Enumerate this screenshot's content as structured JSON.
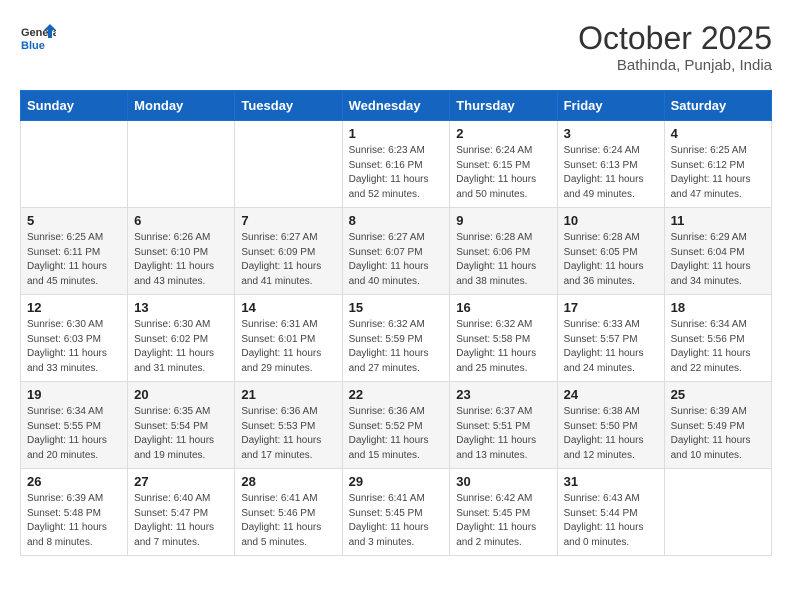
{
  "header": {
    "logo_line1": "General",
    "logo_line2": "Blue",
    "month_year": "October 2025",
    "location": "Bathinda, Punjab, India"
  },
  "days_of_week": [
    "Sunday",
    "Monday",
    "Tuesday",
    "Wednesday",
    "Thursday",
    "Friday",
    "Saturday"
  ],
  "weeks": [
    [
      {
        "day": "",
        "detail": ""
      },
      {
        "day": "",
        "detail": ""
      },
      {
        "day": "",
        "detail": ""
      },
      {
        "day": "1",
        "detail": "Sunrise: 6:23 AM\nSunset: 6:16 PM\nDaylight: 11 hours\nand 52 minutes."
      },
      {
        "day": "2",
        "detail": "Sunrise: 6:24 AM\nSunset: 6:15 PM\nDaylight: 11 hours\nand 50 minutes."
      },
      {
        "day": "3",
        "detail": "Sunrise: 6:24 AM\nSunset: 6:13 PM\nDaylight: 11 hours\nand 49 minutes."
      },
      {
        "day": "4",
        "detail": "Sunrise: 6:25 AM\nSunset: 6:12 PM\nDaylight: 11 hours\nand 47 minutes."
      }
    ],
    [
      {
        "day": "5",
        "detail": "Sunrise: 6:25 AM\nSunset: 6:11 PM\nDaylight: 11 hours\nand 45 minutes."
      },
      {
        "day": "6",
        "detail": "Sunrise: 6:26 AM\nSunset: 6:10 PM\nDaylight: 11 hours\nand 43 minutes."
      },
      {
        "day": "7",
        "detail": "Sunrise: 6:27 AM\nSunset: 6:09 PM\nDaylight: 11 hours\nand 41 minutes."
      },
      {
        "day": "8",
        "detail": "Sunrise: 6:27 AM\nSunset: 6:07 PM\nDaylight: 11 hours\nand 40 minutes."
      },
      {
        "day": "9",
        "detail": "Sunrise: 6:28 AM\nSunset: 6:06 PM\nDaylight: 11 hours\nand 38 minutes."
      },
      {
        "day": "10",
        "detail": "Sunrise: 6:28 AM\nSunset: 6:05 PM\nDaylight: 11 hours\nand 36 minutes."
      },
      {
        "day": "11",
        "detail": "Sunrise: 6:29 AM\nSunset: 6:04 PM\nDaylight: 11 hours\nand 34 minutes."
      }
    ],
    [
      {
        "day": "12",
        "detail": "Sunrise: 6:30 AM\nSunset: 6:03 PM\nDaylight: 11 hours\nand 33 minutes."
      },
      {
        "day": "13",
        "detail": "Sunrise: 6:30 AM\nSunset: 6:02 PM\nDaylight: 11 hours\nand 31 minutes."
      },
      {
        "day": "14",
        "detail": "Sunrise: 6:31 AM\nSunset: 6:01 PM\nDaylight: 11 hours\nand 29 minutes."
      },
      {
        "day": "15",
        "detail": "Sunrise: 6:32 AM\nSunset: 5:59 PM\nDaylight: 11 hours\nand 27 minutes."
      },
      {
        "day": "16",
        "detail": "Sunrise: 6:32 AM\nSunset: 5:58 PM\nDaylight: 11 hours\nand 25 minutes."
      },
      {
        "day": "17",
        "detail": "Sunrise: 6:33 AM\nSunset: 5:57 PM\nDaylight: 11 hours\nand 24 minutes."
      },
      {
        "day": "18",
        "detail": "Sunrise: 6:34 AM\nSunset: 5:56 PM\nDaylight: 11 hours\nand 22 minutes."
      }
    ],
    [
      {
        "day": "19",
        "detail": "Sunrise: 6:34 AM\nSunset: 5:55 PM\nDaylight: 11 hours\nand 20 minutes."
      },
      {
        "day": "20",
        "detail": "Sunrise: 6:35 AM\nSunset: 5:54 PM\nDaylight: 11 hours\nand 19 minutes."
      },
      {
        "day": "21",
        "detail": "Sunrise: 6:36 AM\nSunset: 5:53 PM\nDaylight: 11 hours\nand 17 minutes."
      },
      {
        "day": "22",
        "detail": "Sunrise: 6:36 AM\nSunset: 5:52 PM\nDaylight: 11 hours\nand 15 minutes."
      },
      {
        "day": "23",
        "detail": "Sunrise: 6:37 AM\nSunset: 5:51 PM\nDaylight: 11 hours\nand 13 minutes."
      },
      {
        "day": "24",
        "detail": "Sunrise: 6:38 AM\nSunset: 5:50 PM\nDaylight: 11 hours\nand 12 minutes."
      },
      {
        "day": "25",
        "detail": "Sunrise: 6:39 AM\nSunset: 5:49 PM\nDaylight: 11 hours\nand 10 minutes."
      }
    ],
    [
      {
        "day": "26",
        "detail": "Sunrise: 6:39 AM\nSunset: 5:48 PM\nDaylight: 11 hours\nand 8 minutes."
      },
      {
        "day": "27",
        "detail": "Sunrise: 6:40 AM\nSunset: 5:47 PM\nDaylight: 11 hours\nand 7 minutes."
      },
      {
        "day": "28",
        "detail": "Sunrise: 6:41 AM\nSunset: 5:46 PM\nDaylight: 11 hours\nand 5 minutes."
      },
      {
        "day": "29",
        "detail": "Sunrise: 6:41 AM\nSunset: 5:45 PM\nDaylight: 11 hours\nand 3 minutes."
      },
      {
        "day": "30",
        "detail": "Sunrise: 6:42 AM\nSunset: 5:45 PM\nDaylight: 11 hours\nand 2 minutes."
      },
      {
        "day": "31",
        "detail": "Sunrise: 6:43 AM\nSunset: 5:44 PM\nDaylight: 11 hours\nand 0 minutes."
      },
      {
        "day": "",
        "detail": ""
      }
    ]
  ]
}
